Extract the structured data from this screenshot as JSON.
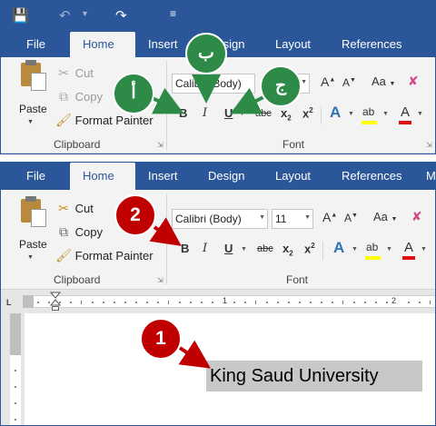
{
  "quick_access": {
    "save_icon": "save-icon",
    "undo_icon": "undo-icon",
    "redo_icon": "redo-icon",
    "customize_icon": "customize-qat-icon"
  },
  "tabs": [
    "File",
    "Home",
    "Insert",
    "Design",
    "Layout",
    "References",
    "M"
  ],
  "clipboard": {
    "paste_label": "Paste",
    "cut_label": "Cut",
    "copy_label": "Copy",
    "format_painter_label": "Format Painter",
    "group_label": "Clipboard"
  },
  "font_group": {
    "font_name": "Calibri (Body)",
    "font_size": "11",
    "grow_label": "A",
    "shrink_label": "A",
    "change_case_label": "Aa",
    "bold_label": "B",
    "italic_label": "I",
    "underline_label": "U",
    "strikethrough_label": "abc",
    "subscript_label": "x",
    "superscript_label": "x",
    "subscript_mark": "2",
    "superscript_mark": "2",
    "text_effects_label": "A",
    "highlight_label": "ab",
    "font_color_label": "A",
    "group_label": "Font"
  },
  "ruler": {
    "tab_selector": "L",
    "numbers": [
      "1",
      "2"
    ]
  },
  "document": {
    "selected_text": "King Saud University"
  },
  "callouts": {
    "green_alef": "أ",
    "green_ba": "ب",
    "green_jim": "ج",
    "red_one": "1",
    "red_two": "2"
  },
  "colors": {
    "title_bar": "#2b579a",
    "ribbon": "#f3f3f3",
    "callout_green": "#2e8b47",
    "callout_red": "#c00000",
    "highlight_yellow": "#ffff00",
    "font_color_red": "#e01010",
    "selection_gray": "#c8c8c8"
  }
}
